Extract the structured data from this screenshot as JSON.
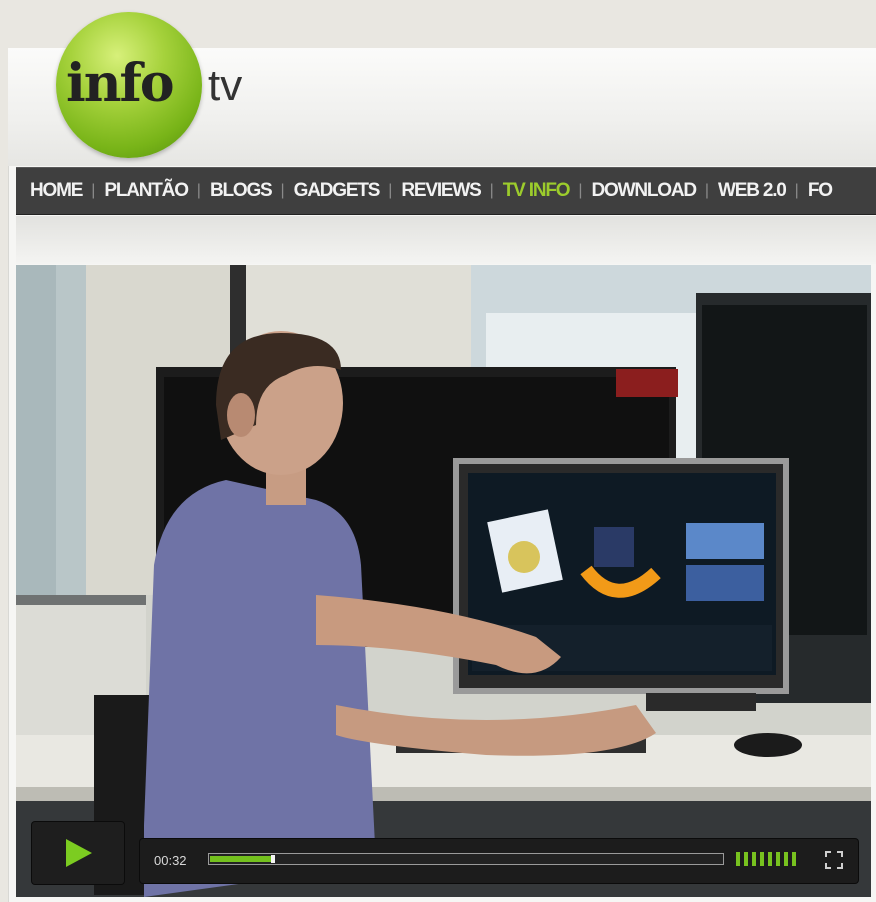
{
  "header": {
    "logo_main": "info",
    "logo_sub": "tv"
  },
  "nav": {
    "items": [
      {
        "label": "HOME",
        "active": false
      },
      {
        "label": "PLANTÃO",
        "active": false
      },
      {
        "label": "BLOGS",
        "active": false
      },
      {
        "label": "GADGETS",
        "active": false
      },
      {
        "label": "REVIEWS",
        "active": false
      },
      {
        "label": "TV INFO",
        "active": true
      },
      {
        "label": "DOWNLOAD",
        "active": false
      },
      {
        "label": "WEB 2.0",
        "active": false
      },
      {
        "label": "FO",
        "active": false
      }
    ]
  },
  "player": {
    "current_time": "00:32",
    "progress": 0.12,
    "volume_bars": 8,
    "play_icon": "play-icon",
    "fullscreen_icon": "fullscreen-icon"
  },
  "colors": {
    "accent_green": "#9ccc2c",
    "nav_bg": "#3f3f3f",
    "progress_green": "#74c11e"
  }
}
